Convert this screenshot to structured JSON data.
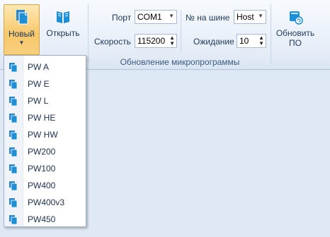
{
  "ribbon": {
    "new_label": "Новый",
    "open_label": "Открыть",
    "update_label_line1": "Обновить",
    "update_label_line2": "ПО",
    "group_title": "Обновление микропрограммы",
    "port_label": "Порт",
    "port_value": "COM1",
    "bus_label": "№ на шине",
    "bus_value": "Host",
    "speed_label": "Скорость",
    "speed_value": "115200",
    "wait_label": "Ожидание",
    "wait_value": "10"
  },
  "menu": {
    "items": [
      "PW A",
      "PW E",
      "PW L",
      "PW HE",
      "PW HW",
      "PW200",
      "PW100",
      "PW400",
      "PW400v3",
      "PW450"
    ]
  },
  "colors": {
    "accent": "#1e8fd6",
    "ribbon_bg": "#e6eef8",
    "body_bg": "#dfe9f5"
  }
}
